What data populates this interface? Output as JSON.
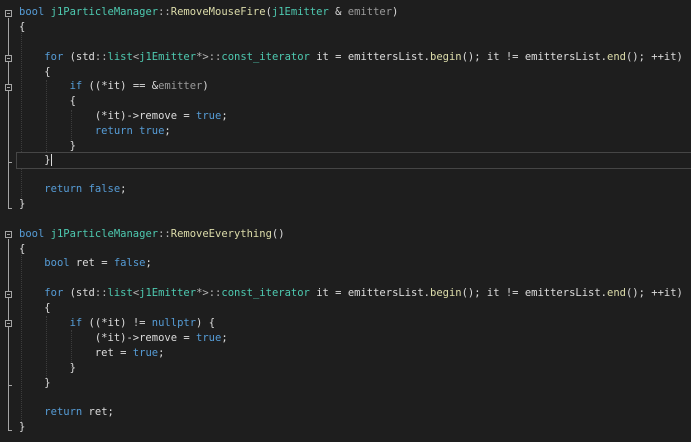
{
  "lines": {
    "l1": [
      "bool",
      " ",
      "j1ParticleManager",
      "::",
      "RemoveMouseFire",
      "(",
      "j1Emitter",
      " & ",
      "emitter",
      ")"
    ],
    "l2": [
      "{"
    ],
    "l3": [],
    "l4": [
      "    ",
      "for",
      " (std",
      "::",
      "list",
      "<",
      "j1Emitter",
      "*>",
      "::",
      "const_iterator",
      " it = emittersList.",
      "begin",
      "(); it != emittersList.",
      "end",
      "(); ++it)"
    ],
    "l5": [
      "    ",
      "{"
    ],
    "l6": [
      "        ",
      "if",
      " ((",
      "*it",
      ") == &",
      "emitter",
      ")"
    ],
    "l7": [
      "        ",
      "{"
    ],
    "l8": [
      "            ",
      "(*it)->remove = ",
      "true",
      ";"
    ],
    "l9": [
      "            ",
      "return",
      " ",
      "true",
      ";"
    ],
    "l10": [
      "        ",
      "}"
    ],
    "l11": [
      "    ",
      "}"
    ],
    "l12": [],
    "l13": [
      "    ",
      "return",
      " ",
      "false",
      ";"
    ],
    "l14": [
      "}"
    ],
    "l15": [],
    "l16": [
      "bool",
      " ",
      "j1ParticleManager",
      "::",
      "RemoveEverything",
      "()"
    ],
    "l17": [
      "{"
    ],
    "l18": [
      "    ",
      "bool",
      " ret = ",
      "false",
      ";"
    ],
    "l19": [],
    "l20": [
      "    ",
      "for",
      " (std",
      "::",
      "list",
      "<",
      "j1Emitter",
      "*>",
      "::",
      "const_iterator",
      " it = emittersList.",
      "begin",
      "(); it != emittersList.",
      "end",
      "(); ++it)"
    ],
    "l21": [
      "    ",
      "{"
    ],
    "l22": [
      "        ",
      "if",
      " ((",
      "*it",
      ") != ",
      "nullptr",
      ") {"
    ],
    "l23": [
      "            ",
      "(*it)->remove = ",
      "true",
      ";"
    ],
    "l24": [
      "            ",
      "ret = ",
      "true",
      ";"
    ],
    "l25": [
      "        ",
      "}"
    ],
    "l26": [
      "    ",
      "}"
    ],
    "l27": [],
    "l28": [
      "    ",
      "return",
      " ret;"
    ],
    "l29": [
      "}"
    ]
  }
}
